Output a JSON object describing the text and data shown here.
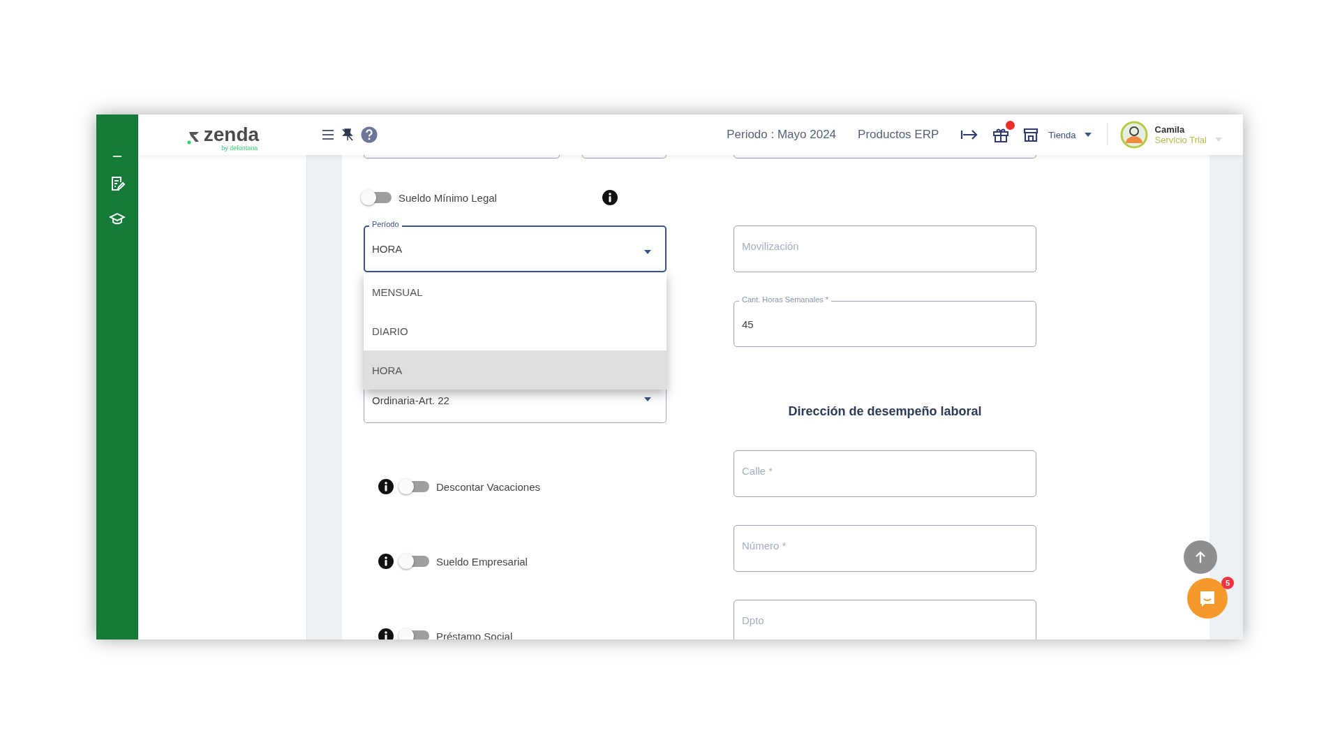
{
  "brand": {
    "name": "zenda",
    "tagline": "by defontana"
  },
  "topbar": {
    "period": "Periodo : Mayo 2024",
    "products": "Productos ERP",
    "gift_notification": true,
    "store": "Tienda",
    "user": {
      "name": "Camila",
      "role": "Servicio Trial"
    }
  },
  "minimum_wage_toggle": {
    "label": "Sueldo Mínimo Legal",
    "on": false
  },
  "period_select": {
    "label": "Período",
    "value": "HORA",
    "open": true,
    "options": [
      {
        "label": "MENSUAL",
        "selected": false
      },
      {
        "label": "DIARIO",
        "selected": false
      },
      {
        "label": "HORA",
        "selected": true
      }
    ]
  },
  "workday_select": {
    "value": "Ordinaria-Art. 22"
  },
  "toggles": [
    {
      "label": "Descontar Vacaciones",
      "on": false
    },
    {
      "label": "Sueldo Empresarial",
      "on": false
    },
    {
      "label": "Préstamo Social",
      "on": false
    }
  ],
  "mobility_field": {
    "placeholder": "Movilización"
  },
  "hours_field": {
    "label": "Cant. Horas Semanales *",
    "value": "45"
  },
  "address": {
    "heading": "Dirección de desempeño laboral",
    "fields": [
      {
        "placeholder": "Calle *"
      },
      {
        "placeholder": "Número *"
      },
      {
        "placeholder": "Dpto"
      }
    ]
  },
  "chat": {
    "badge": "5"
  }
}
